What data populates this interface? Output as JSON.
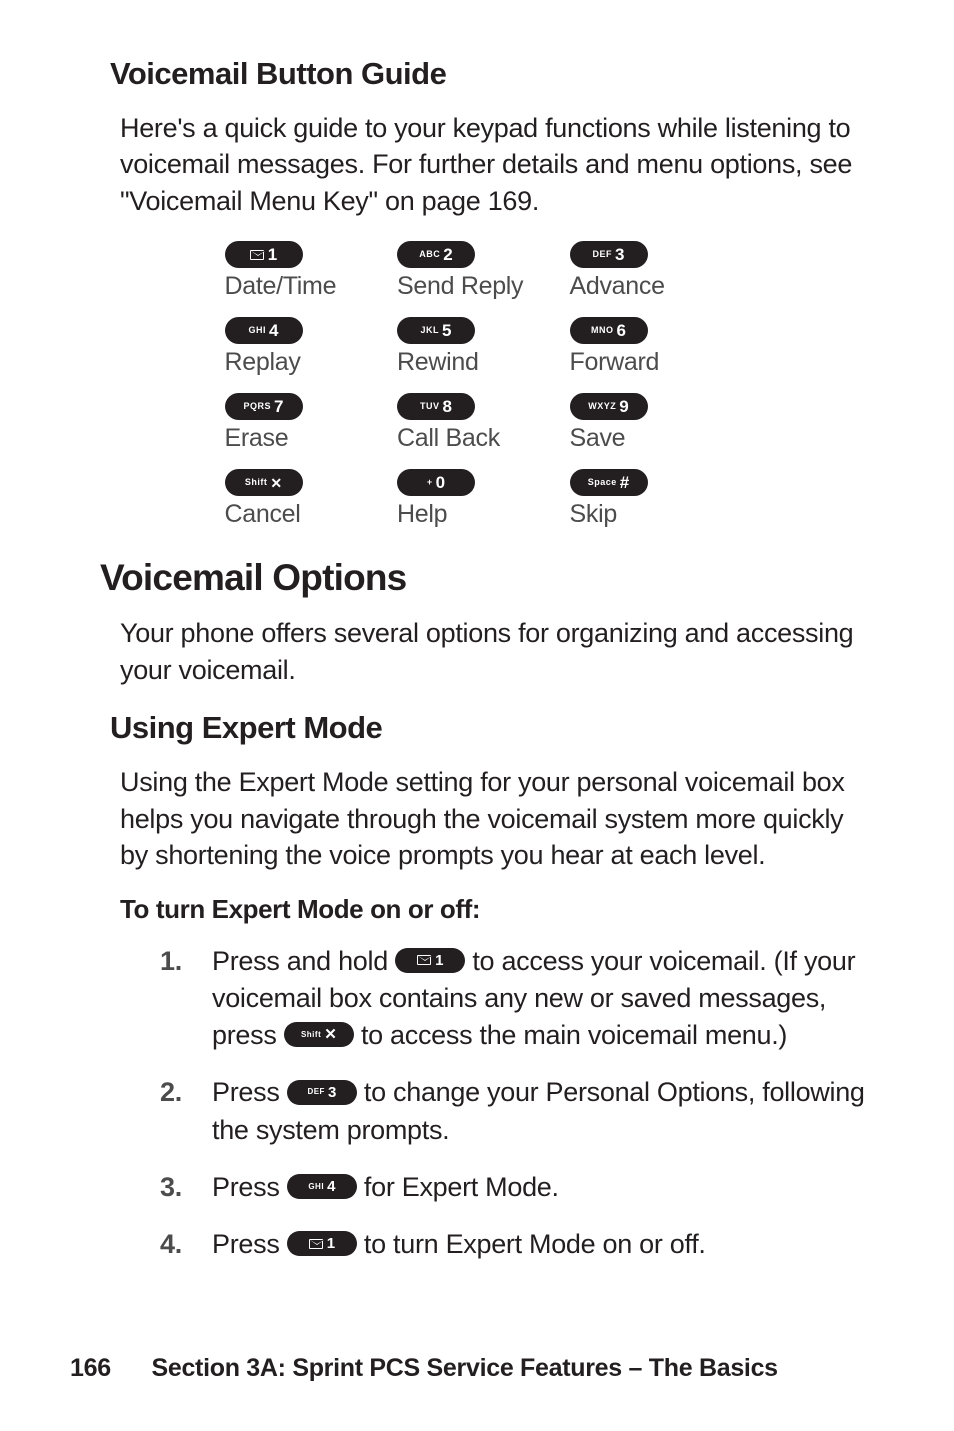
{
  "section1": {
    "heading": "Voicemail Button Guide",
    "intro": "Here's a quick guide to your keypad functions while listening to voicemail messages. For further details and menu options, see \"Voicemail Menu Key\" on page 169."
  },
  "keypad": [
    [
      {
        "sub": "",
        "main": "1",
        "icon": "envelope",
        "label": "Date/Time"
      },
      {
        "sub": "ABC",
        "main": "2",
        "label": "Send Reply"
      },
      {
        "sub": "DEF",
        "main": "3",
        "label": "Advance"
      }
    ],
    [
      {
        "sub": "GHI",
        "main": "4",
        "label": "Replay"
      },
      {
        "sub": "JKL",
        "main": "5",
        "label": "Rewind"
      },
      {
        "sub": "MNO",
        "main": "6",
        "label": "Forward"
      }
    ],
    [
      {
        "sub": "PQRS",
        "main": "7",
        "label": "Erase"
      },
      {
        "sub": "TUV",
        "main": "8",
        "label": "Call Back"
      },
      {
        "sub": "WXYZ",
        "main": "9",
        "label": "Save"
      }
    ],
    [
      {
        "sub": "Shift",
        "main": "✕",
        "label": "Cancel"
      },
      {
        "sub": "+",
        "main": "0",
        "label": "Help"
      },
      {
        "sub": "Space",
        "main": "#",
        "label": "Skip"
      }
    ]
  ],
  "section2": {
    "heading": "Voicemail Options",
    "intro": "Your phone offers several options for organizing and accessing your voicemail."
  },
  "section3": {
    "heading": "Using Expert Mode",
    "intro": "Using the Expert Mode setting for your personal voicemail box helps you navigate through the voicemail system more quickly by shortening the voice prompts you hear at each level.",
    "procTitle": "To turn Expert Mode on or off:"
  },
  "steps": {
    "s1_a": "Press and hold ",
    "s1_b": " to access your voicemail. (If your voicemail box contains any new or saved messages, press ",
    "s1_c": " to access the main voicemail menu.)",
    "s2_a": "Press ",
    "s2_b": " to change your Personal Options, following the system prompts.",
    "s3_a": "Press ",
    "s3_b": " for Expert Mode.",
    "s4_a": "Press ",
    "s4_b": " to turn Expert Mode on or off."
  },
  "inline_keys": {
    "k1": {
      "sub": "",
      "main": "1",
      "icon": "envelope"
    },
    "kStar": {
      "sub": "Shift",
      "main": "✕"
    },
    "k3": {
      "sub": "DEF",
      "main": "3"
    },
    "k4": {
      "sub": "GHI",
      "main": "4"
    }
  },
  "footer": {
    "page": "166",
    "section": "Section 3A: Sprint PCS Service Features – The Basics"
  }
}
